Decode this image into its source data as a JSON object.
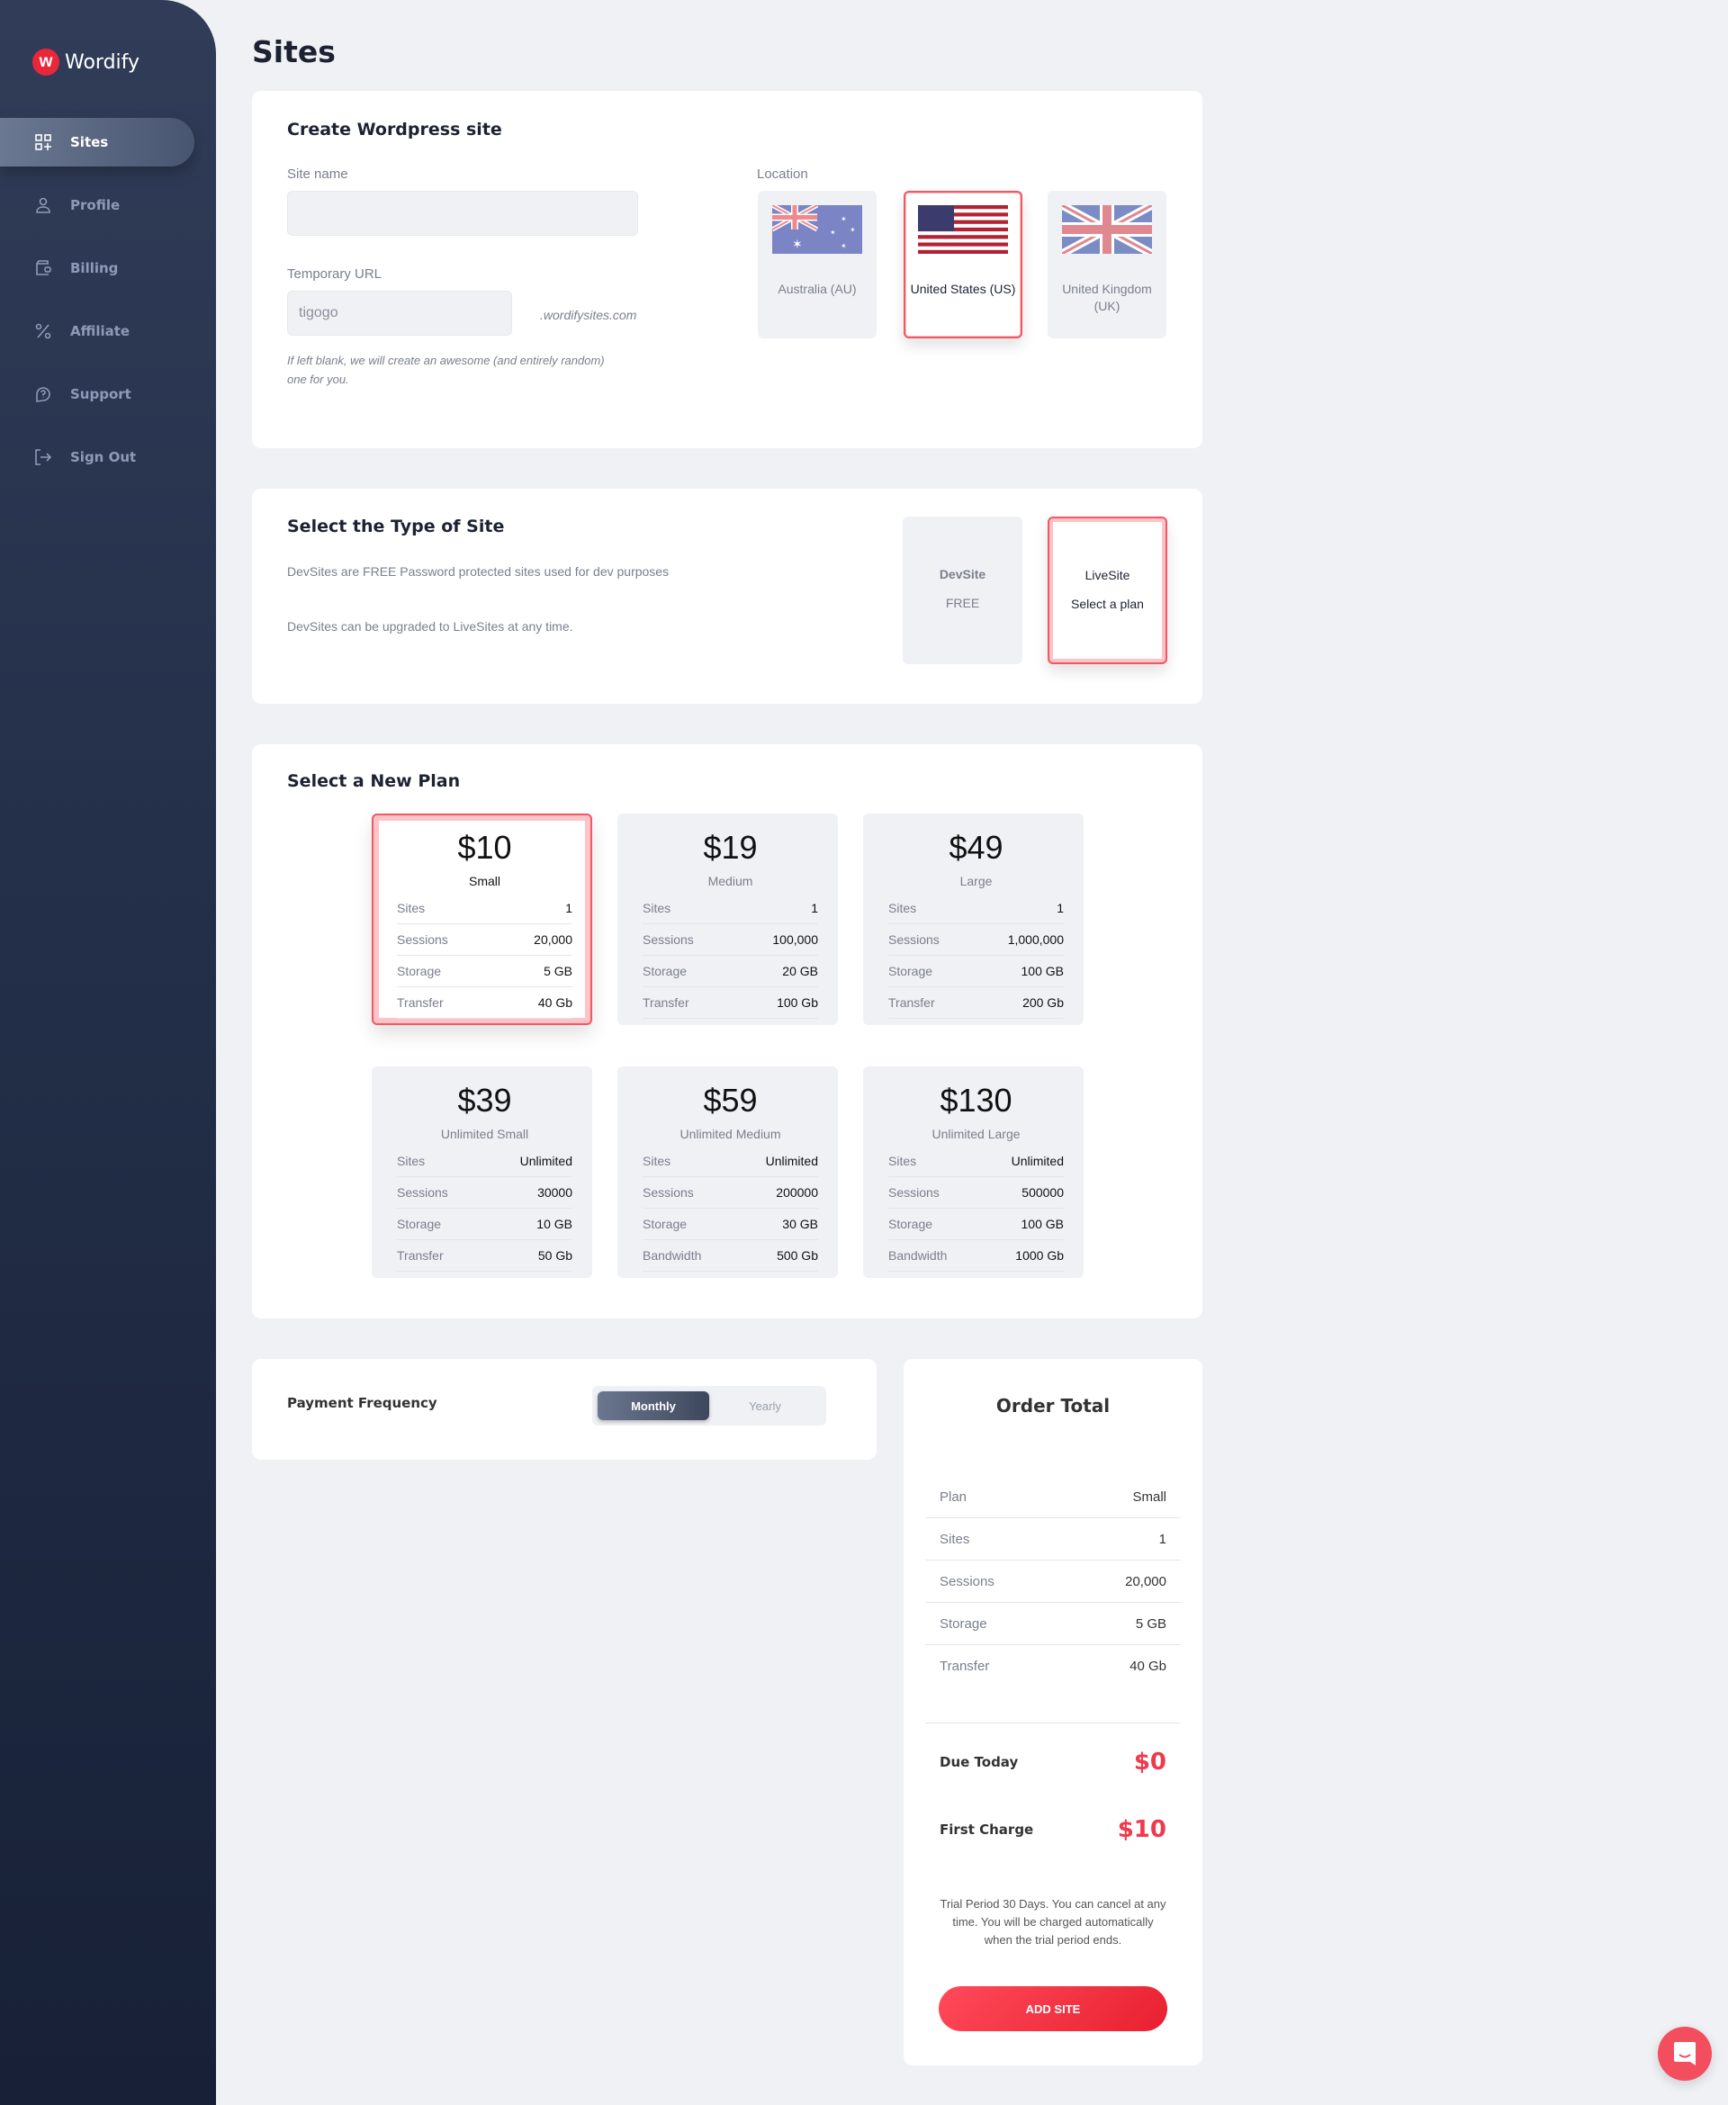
{
  "app": {
    "name": "Wordify"
  },
  "sidebar": {
    "items": [
      {
        "label": "Sites",
        "icon": "grid-plus-icon",
        "active": true
      },
      {
        "label": "Profile",
        "icon": "user-icon"
      },
      {
        "label": "Billing",
        "icon": "wallet-icon"
      },
      {
        "label": "Affiliate",
        "icon": "percent-icon"
      },
      {
        "label": "Support",
        "icon": "help-chat-icon"
      },
      {
        "label": "Sign Out",
        "icon": "sign-out-icon"
      }
    ]
  },
  "page": {
    "title": "Sites"
  },
  "create": {
    "title": "Create Wordpress site",
    "site_name_label": "Site name",
    "site_name_value": "",
    "temp_url_label": "Temporary URL",
    "temp_url_value": "tigogo",
    "domain_suffix": ".wordifysites.com",
    "hint": "If left blank, we will create an awesome (and entirely random) one for you.",
    "location_label": "Location",
    "locations": [
      {
        "label": "Australia (AU)",
        "flag": "au-flag-icon",
        "selected": false
      },
      {
        "label": "United States (US)",
        "flag": "us-flag-icon",
        "selected": true
      },
      {
        "label": "United Kingdom (UK)",
        "flag": "uk-flag-icon",
        "selected": false
      }
    ]
  },
  "site_type": {
    "title": "Select the Type of Site",
    "desc1": "DevSites are FREE Password protected sites used for dev purposes",
    "desc2": "DevSites can be upgraded to LiveSites at any time.",
    "options": [
      {
        "name": "DevSite",
        "sub": "FREE",
        "selected": false
      },
      {
        "name": "LiveSite",
        "sub": "Select a plan",
        "selected": true
      }
    ]
  },
  "plans": {
    "title": "Select a New Plan",
    "items": [
      {
        "price": "$10",
        "name": "Small",
        "selected": true,
        "rows": [
          [
            "Sites",
            "1"
          ],
          [
            "Sessions",
            "20,000"
          ],
          [
            "Storage",
            "5 GB"
          ],
          [
            "Transfer",
            "40 Gb"
          ]
        ]
      },
      {
        "price": "$19",
        "name": "Medium",
        "rows": [
          [
            "Sites",
            "1"
          ],
          [
            "Sessions",
            "100,000"
          ],
          [
            "Storage",
            "20 GB"
          ],
          [
            "Transfer",
            "100 Gb"
          ]
        ]
      },
      {
        "price": "$49",
        "name": "Large",
        "rows": [
          [
            "Sites",
            "1"
          ],
          [
            "Sessions",
            "1,000,000"
          ],
          [
            "Storage",
            "100 GB"
          ],
          [
            "Transfer",
            "200 Gb"
          ]
        ]
      },
      {
        "price": "$39",
        "name": "Unlimited Small",
        "rows": [
          [
            "Sites",
            "Unlimited"
          ],
          [
            "Sessions",
            "30000"
          ],
          [
            "Storage",
            "10 GB"
          ],
          [
            "Transfer",
            "50 Gb"
          ]
        ]
      },
      {
        "price": "$59",
        "name": "Unlimited Medium",
        "rows": [
          [
            "Sites",
            "Unlimited"
          ],
          [
            "Sessions",
            "200000"
          ],
          [
            "Storage",
            "30 GB"
          ],
          [
            "Bandwidth",
            "500 Gb"
          ]
        ]
      },
      {
        "price": "$130",
        "name": "Unlimited Large",
        "rows": [
          [
            "Sites",
            "Unlimited"
          ],
          [
            "Sessions",
            "500000"
          ],
          [
            "Storage",
            "100 GB"
          ],
          [
            "Bandwidth",
            "1000 Gb"
          ]
        ]
      }
    ]
  },
  "payment": {
    "label": "Payment Frequency",
    "options": [
      "Monthly",
      "Yearly"
    ],
    "selected": "Monthly"
  },
  "order": {
    "title": "Order Total",
    "rows": [
      [
        "Plan",
        "Small"
      ],
      [
        "Sites",
        "1"
      ],
      [
        "Sessions",
        "20,000"
      ],
      [
        "Storage",
        "5 GB"
      ],
      [
        "Transfer",
        "40 Gb"
      ]
    ],
    "due_today_label": "Due Today",
    "due_today": "$0",
    "first_charge_label": "First Charge",
    "first_charge": "$10",
    "note": "Trial Period 30 Days. You can cancel at any time. You will be charged automatically when the trial period ends.",
    "button": "ADD SITE"
  },
  "colors": {
    "accent": "#f03a4c",
    "sidebar": "#24304a",
    "selected_border": "#f05864"
  }
}
